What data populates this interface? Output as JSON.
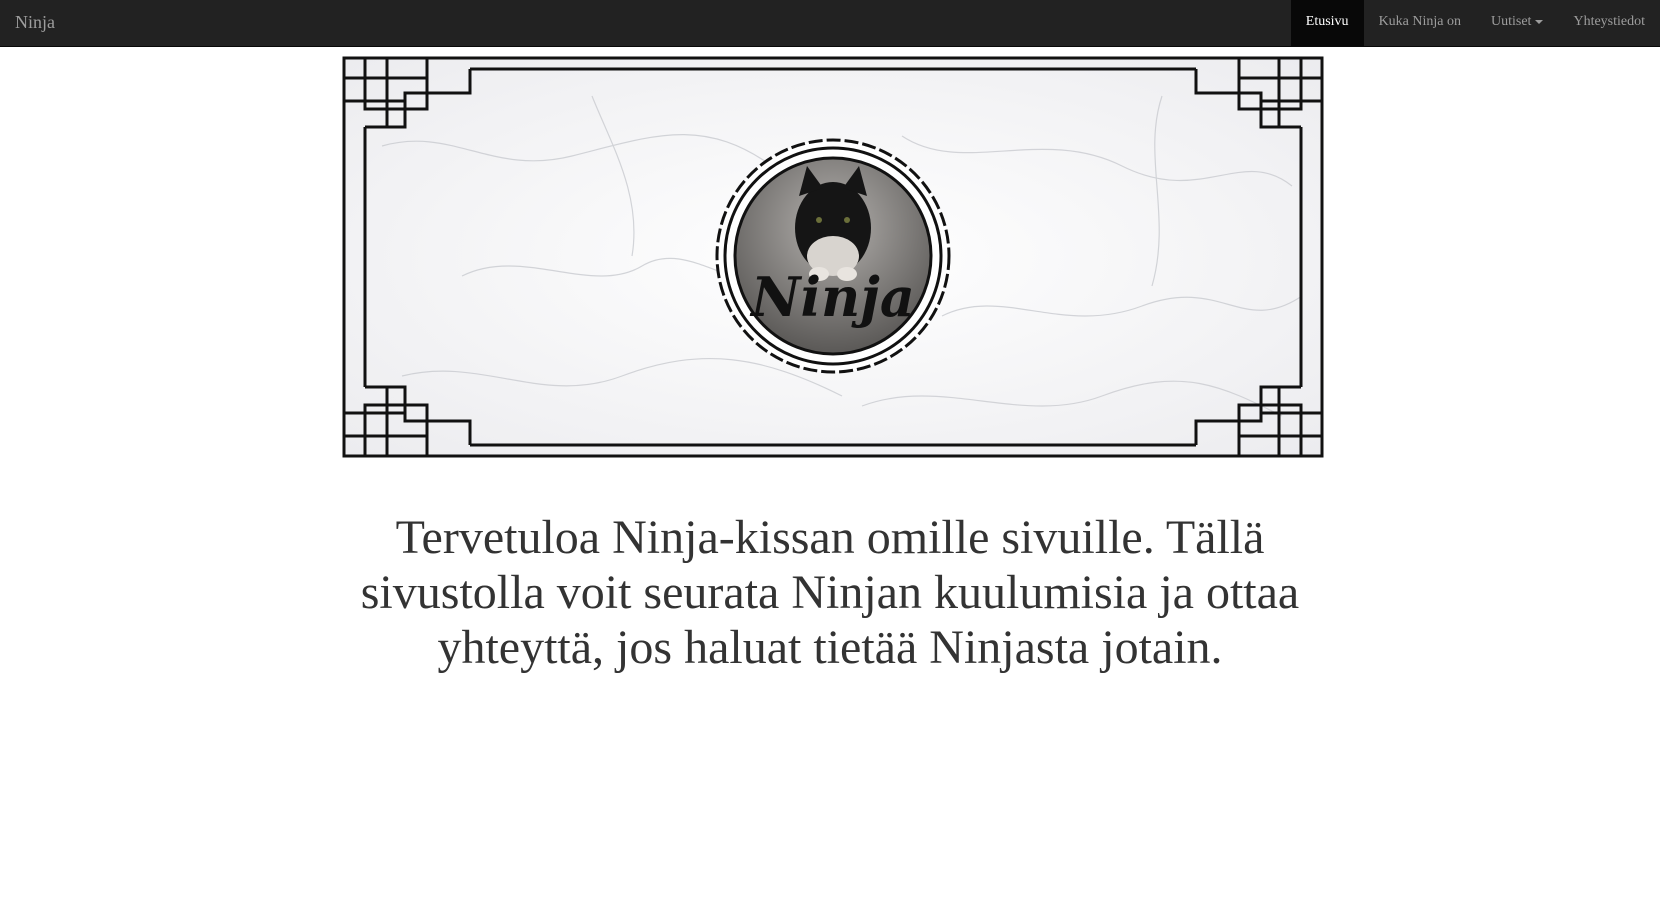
{
  "navbar": {
    "brand": "Ninja",
    "items": [
      {
        "label": "Etusivu",
        "active": true
      },
      {
        "label": "Kuka Ninja on",
        "active": false
      },
      {
        "label": "Uutiset",
        "active": false,
        "dropdown": true
      },
      {
        "label": "Yhteystiedot",
        "active": false
      }
    ]
  },
  "hero": {
    "logo_text": "Ninja"
  },
  "main": {
    "welcome_text": "Tervetuloa Ninja-kissan omille sivuille. Tällä sivustolla voit seurata Ninjan kuulumisia ja ottaa yhteyttä, jos haluat tietää Ninjasta jotain."
  },
  "colors": {
    "navbar_bg": "#222222",
    "navbar_text": "#9d9d9d",
    "navbar_active_bg": "#080808",
    "body_text": "#333333"
  }
}
